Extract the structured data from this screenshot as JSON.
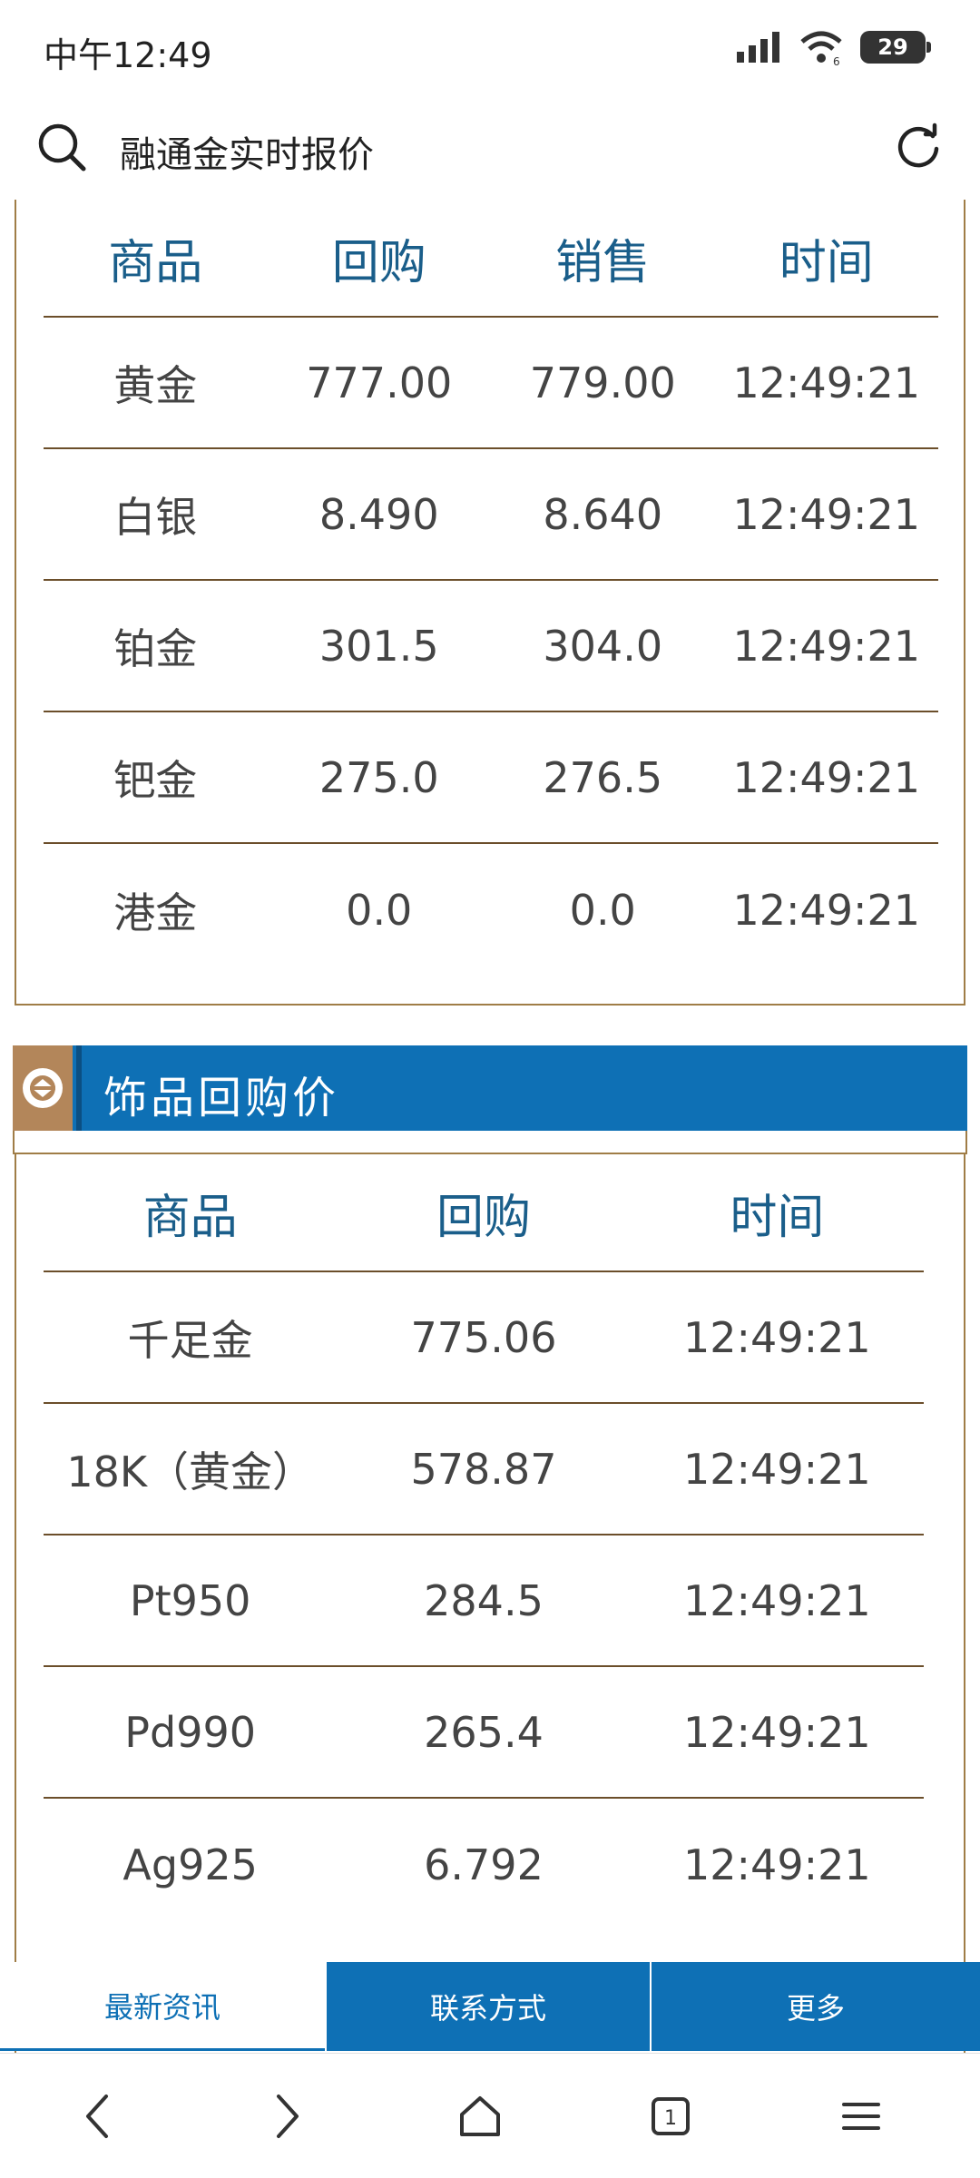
{
  "status": {
    "time": "中午12:49",
    "battery": "29"
  },
  "address": {
    "title": "融通金实时报价"
  },
  "quote_table": {
    "headers": [
      "商品",
      "回购",
      "销售",
      "时间"
    ],
    "rows": [
      [
        "黄金",
        "777.00",
        "779.00",
        "12:49:21"
      ],
      [
        "白银",
        "8.490",
        "8.640",
        "12:49:21"
      ],
      [
        "铂金",
        "301.5",
        "304.0",
        "12:49:21"
      ],
      [
        "钯金",
        "275.0",
        "276.5",
        "12:49:21"
      ],
      [
        "港金",
        "0.0",
        "0.0",
        "12:49:21"
      ]
    ]
  },
  "section": {
    "title": "饰品回购价"
  },
  "jewelry_table": {
    "headers": [
      "商品",
      "回购",
      "时间"
    ],
    "rows": [
      [
        "千足金",
        "775.06",
        "12:49:21"
      ],
      [
        "18K（黄金）",
        "578.87",
        "12:49:21"
      ],
      [
        "Pt950",
        "284.5",
        "12:49:21"
      ],
      [
        "Pd990",
        "265.4",
        "12:49:21"
      ],
      [
        "Ag925",
        "6.792",
        "12:49:21"
      ]
    ]
  },
  "tabs": {
    "news": "最新资讯",
    "contact": "联系方式",
    "more": "更多"
  },
  "nav": {
    "tab_count": "1"
  },
  "colors": {
    "accent": "#0e70b5",
    "border": "#a07d47",
    "header_text": "#1a5e8a"
  }
}
